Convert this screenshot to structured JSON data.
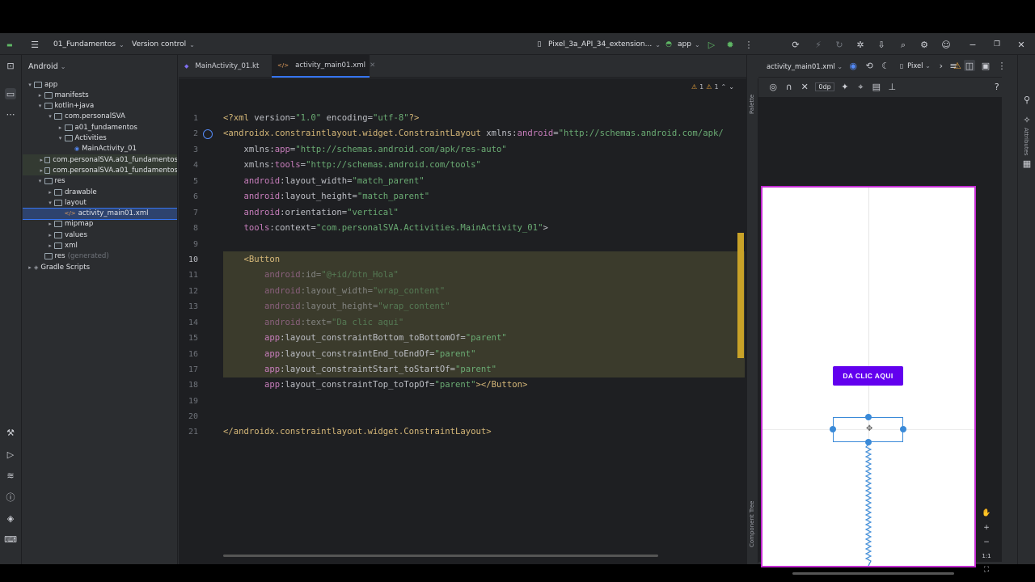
{
  "titlebar": {
    "project_name": "01_Fundamentos",
    "vcs_label": "Version control",
    "device_label": "Pixel_3a_API_34_extension...",
    "run_config": "app"
  },
  "project_panel": {
    "view_label": "Android",
    "tree": [
      {
        "label": "app",
        "depth": 0,
        "expanded": true,
        "kind": "folder"
      },
      {
        "label": "manifests",
        "depth": 1,
        "expanded": false,
        "kind": "folder"
      },
      {
        "label": "kotlin+java",
        "depth": 1,
        "expanded": true,
        "kind": "folder"
      },
      {
        "label": "com.personalSVA",
        "depth": 2,
        "expanded": true,
        "kind": "folder"
      },
      {
        "label": "a01_fundamentos",
        "depth": 3,
        "expanded": false,
        "kind": "folder"
      },
      {
        "label": "Activities",
        "depth": 3,
        "expanded": true,
        "kind": "folder"
      },
      {
        "label": "MainActivity_01",
        "depth": 4,
        "expanded": null,
        "kind": "file"
      },
      {
        "label": "com.personalSVA.a01_fundamentos",
        "depth": 2,
        "expanded": false,
        "kind": "folder",
        "hl": true
      },
      {
        "label": "com.personalSVA.a01_fundamentos",
        "depth": 2,
        "expanded": false,
        "kind": "folder",
        "hl": true
      },
      {
        "label": "res",
        "depth": 1,
        "expanded": true,
        "kind": "folder"
      },
      {
        "label": "drawable",
        "depth": 2,
        "expanded": false,
        "kind": "folder"
      },
      {
        "label": "layout",
        "depth": 2,
        "expanded": true,
        "kind": "folder"
      },
      {
        "label": "activity_main01.xml",
        "depth": 3,
        "expanded": null,
        "kind": "xml",
        "sel": true
      },
      {
        "label": "mipmap",
        "depth": 2,
        "expanded": false,
        "kind": "folder"
      },
      {
        "label": "values",
        "depth": 2,
        "expanded": false,
        "kind": "folder"
      },
      {
        "label": "xml",
        "depth": 2,
        "expanded": false,
        "kind": "folder"
      },
      {
        "label": "res",
        "suffix": "(generated)",
        "depth": 1,
        "expanded": null,
        "kind": "folder"
      },
      {
        "label": "Gradle Scripts",
        "depth": 0,
        "expanded": false,
        "kind": "gradle"
      }
    ]
  },
  "editor": {
    "tabs": [
      {
        "label": "MainActivity_01.kt",
        "active": false
      },
      {
        "label": "activity_main01.xml",
        "active": true
      }
    ],
    "warnings": "1",
    "weak_warnings": "1",
    "line_numbers": [
      "1",
      "2",
      "3",
      "4",
      "5",
      "6",
      "7",
      "8",
      "9",
      "10",
      "11",
      "12",
      "13",
      "14",
      "15",
      "16",
      "17",
      "18",
      "19",
      "20",
      "21"
    ]
  },
  "design": {
    "file_label": "activity_main01.xml",
    "device_label": "Pixel",
    "margin_label": "0dp",
    "palette_label": "Palette",
    "component_tree_label": "Component Tree",
    "attributes_label": "Attributes",
    "button_text": "DA CLIC AQUI",
    "zoom_ratio": "1:1"
  },
  "colors": {
    "accent": "#3574f0",
    "button_purple": "#6200ee",
    "phone_border": "#c42bd3",
    "change_marker": "#c8a228"
  }
}
